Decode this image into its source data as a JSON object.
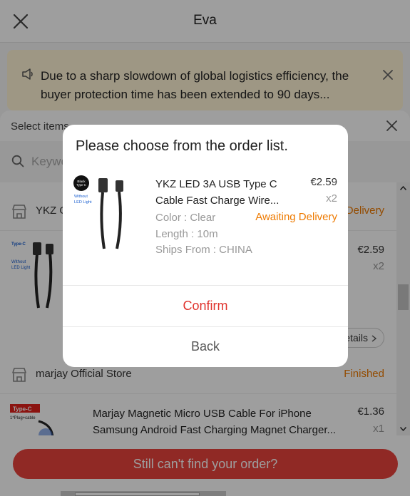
{
  "header": {
    "title": "Eva",
    "close_icon": "close-icon"
  },
  "notice": {
    "text": "Due to a sharp slowdown of global logistics efficiency, the buyer protection time has been extended to 90 days...",
    "icon": "speaker-icon"
  },
  "sheet": {
    "title": "Select items",
    "search_placeholder": "Keywords",
    "stores": [
      {
        "name": "YKZ Official Store",
        "status": "Awaiting Delivery"
      },
      {
        "name": "marjay Official Store",
        "status": "Finished"
      }
    ],
    "orders": [
      {
        "title": "YKZ LED 3A USB Type C Cable Fast Charge Wire...",
        "price": "€2.59",
        "qty": "x2",
        "details_label": "Order details"
      },
      {
        "title_line1": "Marjay Magnetic Micro USB Cable For iPhone",
        "title_line2": "Samsung Android Fast Charging Magnet Charger...",
        "price": "€1.36",
        "qty": "x1",
        "image_label": "Type-C",
        "image_sub": "1*Plug+cable"
      }
    ],
    "cta_label": "Still can't find your order?"
  },
  "modal": {
    "title": "Please choose from the order list.",
    "product_line1": "YKZ LED 3A USB Type C",
    "product_line2": "Cable Fast Charge Wire...",
    "price": "€2.59",
    "qty": "x2",
    "color": "Color : Clear",
    "length": "Length : 10m",
    "ships_from": "Ships From : CHINA",
    "status": "Awaiting Delivery",
    "confirm_label": "Confirm",
    "back_label": "Back",
    "image_badge": "Black Type-C",
    "image_caption": "Without LED Light"
  },
  "colors": {
    "accent_red": "#e8433d",
    "status_orange": "#ee7a00",
    "notice_bg": "#fff4d6"
  }
}
